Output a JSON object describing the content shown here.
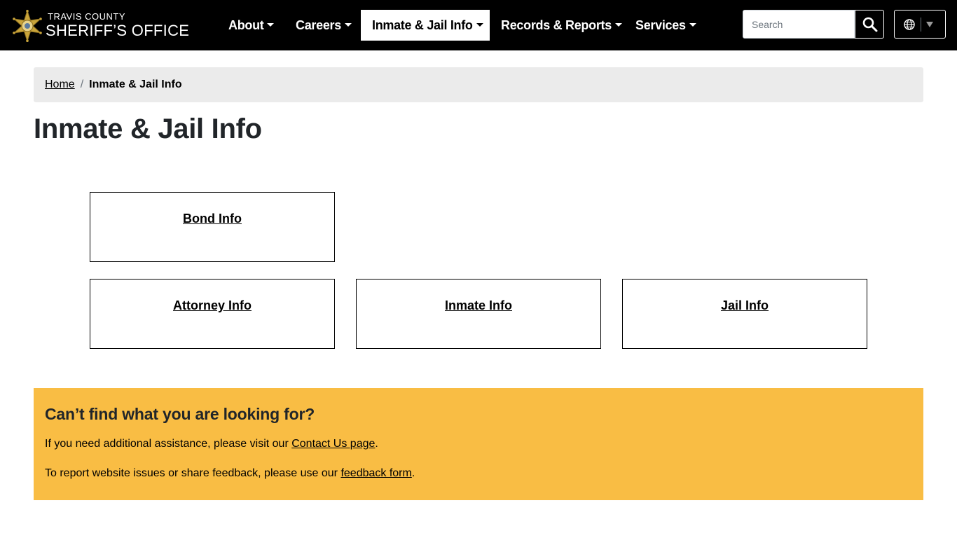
{
  "header": {
    "logo_top": "TRAVIS COUNTY",
    "logo_bottom": "SHERIFF’S OFFICE",
    "badge_icon": "sheriff-star-badge-icon",
    "nav": [
      {
        "label": "About"
      },
      {
        "label": "Careers"
      },
      {
        "label": "Inmate & Jail Info",
        "active": true
      },
      {
        "label": "Records & Reports"
      },
      {
        "label": "Services"
      }
    ],
    "search": {
      "placeholder": "Search",
      "value": "",
      "icon": "search-icon"
    },
    "language": {
      "icon": "globe-icon",
      "caret": "triangle-down-icon"
    }
  },
  "breadcrumb": {
    "home": "Home",
    "divider": "/",
    "current": "Inmate & Jail Info"
  },
  "page": {
    "title": "Inmate & Jail Info"
  },
  "cards": [
    {
      "label": "Bond Info"
    },
    {
      "label": "Attorney Info"
    },
    {
      "label": "Inmate Info"
    },
    {
      "label": "Jail Info"
    }
  ],
  "help": {
    "heading": "Can’t find what you are looking for?",
    "line1_prefix": "If you need additional assistance, please visit our ",
    "line1_link": "Contact Us page",
    "line1_suffix": ".",
    "line2_prefix": "To report website issues or share feedback, please use our ",
    "line2_link": "feedback form",
    "line2_suffix": "."
  },
  "colors": {
    "header_bg": "#000000",
    "breadcrumb_bg": "#ebebeb",
    "help_bg": "#f9bd44",
    "text": "#212529"
  }
}
